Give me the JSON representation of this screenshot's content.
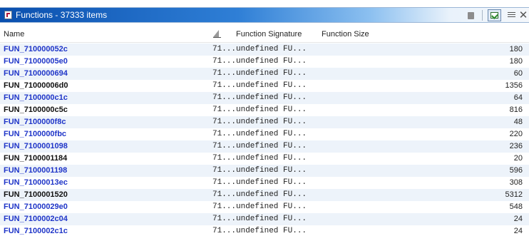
{
  "window": {
    "title": "Functions - 37333 items",
    "close_glyph": "✕"
  },
  "columns": {
    "name": "Name",
    "signature": "Function Signature",
    "size": "Function Size"
  },
  "rows": [
    {
      "name": "FUN_710000052c",
      "addr": "71...",
      "signature": "undefined FU...",
      "size": "180",
      "color": "blue"
    },
    {
      "name": "FUN_71000005e0",
      "addr": "71...",
      "signature": "undefined FU...",
      "size": "180",
      "color": "blue"
    },
    {
      "name": "FUN_7100000694",
      "addr": "71...",
      "signature": "undefined FU...",
      "size": "60",
      "color": "blue"
    },
    {
      "name": "FUN_71000006d0",
      "addr": "71...",
      "signature": "undefined FU...",
      "size": "1356",
      "color": "black"
    },
    {
      "name": "FUN_7100000c1c",
      "addr": "71...",
      "signature": "undefined FU...",
      "size": "64",
      "color": "blue"
    },
    {
      "name": "FUN_7100000c5c",
      "addr": "71...",
      "signature": "undefined FU...",
      "size": "816",
      "color": "black"
    },
    {
      "name": "FUN_7100000f8c",
      "addr": "71...",
      "signature": "undefined FU...",
      "size": "48",
      "color": "blue"
    },
    {
      "name": "FUN_7100000fbc",
      "addr": "71...",
      "signature": "undefined FU...",
      "size": "220",
      "color": "blue"
    },
    {
      "name": "FUN_7100001098",
      "addr": "71...",
      "signature": "undefined FU...",
      "size": "236",
      "color": "blue"
    },
    {
      "name": "FUN_7100001184",
      "addr": "71...",
      "signature": "undefined FU...",
      "size": "20",
      "color": "black"
    },
    {
      "name": "FUN_7100001198",
      "addr": "71...",
      "signature": "undefined FU...",
      "size": "596",
      "color": "blue"
    },
    {
      "name": "FUN_71000013ec",
      "addr": "71...",
      "signature": "undefined FU...",
      "size": "308",
      "color": "blue"
    },
    {
      "name": "FUN_7100001520",
      "addr": "71...",
      "signature": "undefined FU...",
      "size": "5312",
      "color": "black"
    },
    {
      "name": "FUN_71000029e0",
      "addr": "71...",
      "signature": "undefined FU...",
      "size": "548",
      "color": "blue"
    },
    {
      "name": "FUN_7100002c04",
      "addr": "71...",
      "signature": "undefined FU...",
      "size": "24",
      "color": "blue"
    },
    {
      "name": "FUN_7100002c1c",
      "addr": "71...",
      "signature": "undefined FU...",
      "size": "24",
      "color": "blue"
    }
  ],
  "colors": {
    "name_blue": "#1f35c8",
    "name_black": "#111111",
    "row_alt": "#edf3fa",
    "titlebar": "#0a4fae"
  }
}
